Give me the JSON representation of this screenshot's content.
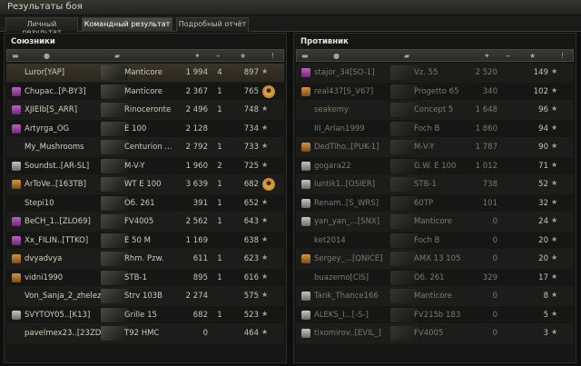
{
  "window": {
    "title": "Результаты боя"
  },
  "tabs": [
    {
      "label": "Личный результат"
    },
    {
      "label": "Командный результат",
      "active": true
    },
    {
      "label": "Подробный отчёт"
    }
  ],
  "allies": {
    "title": "Союзники",
    "rows": [
      {
        "name": "Luror[YAP]",
        "tank": "Manticore",
        "damage": "1 994",
        "frags": "4",
        "xp": "897",
        "rank": "none",
        "badge": "star",
        "me": true
      },
      {
        "name": "Chupac..[P-BY3]",
        "tank": "Manticore",
        "damage": "2 367",
        "frags": "1",
        "xp": "765",
        "rank": "plat",
        "badge": "medal"
      },
      {
        "name": "XJIEIb[S_ARR]",
        "tank": "Rinoceronte",
        "damage": "2 496",
        "frags": "1",
        "xp": "748",
        "rank": "plat",
        "badge": "star"
      },
      {
        "name": "Artyrga_OG",
        "tank": "E 100",
        "damage": "2 128",
        "frags": "",
        "xp": "734",
        "rank": "plat",
        "badge": "star"
      },
      {
        "name": "My_Mushrooms",
        "tank": "Centurion ...",
        "damage": "2 792",
        "frags": "1",
        "xp": "733",
        "rank": "none",
        "badge": "star"
      },
      {
        "name": "Soundst..[AR-SL]",
        "tank": "M-V-Y",
        "damage": "1 960",
        "frags": "2",
        "xp": "725",
        "rank": "silv",
        "badge": "star"
      },
      {
        "name": "ArToVe..[163TB]",
        "tank": "WT E 100",
        "damage": "3 639",
        "frags": "1",
        "xp": "682",
        "rank": "gold",
        "badge": "medal"
      },
      {
        "name": "Stepi10",
        "tank": "Об. 261",
        "damage": "391",
        "frags": "1",
        "xp": "652",
        "rank": "none",
        "badge": "star"
      },
      {
        "name": "BeCH_1..[ZLO69]",
        "tank": "FV4005",
        "damage": "2 562",
        "frags": "1",
        "xp": "643",
        "rank": "plat",
        "badge": "star"
      },
      {
        "name": "Xx_FILIN..[TTKO]",
        "tank": "E 50 M",
        "damage": "1 169",
        "frags": "",
        "xp": "638",
        "rank": "plat",
        "badge": "star"
      },
      {
        "name": "dvyadvya",
        "tank": "Rhm. Pzw.",
        "damage": "611",
        "frags": "1",
        "xp": "623",
        "rank": "gold",
        "badge": "star"
      },
      {
        "name": "vidni1990",
        "tank": "STB-1",
        "damage": "895",
        "frags": "1",
        "xp": "616",
        "rank": "gold",
        "badge": "star"
      },
      {
        "name": "Von_Sanja_2_zhelez",
        "tank": "Strv 103B",
        "damage": "2 274",
        "frags": "",
        "xp": "575",
        "rank": "none",
        "badge": "star"
      },
      {
        "name": "SVYTOY05..[K13]",
        "tank": "Grille 15",
        "damage": "682",
        "frags": "1",
        "xp": "523",
        "rank": "silv",
        "badge": "star"
      },
      {
        "name": "pavelmex23..[23ZD0]",
        "tank": "T92 HMC",
        "damage": "0",
        "frags": "",
        "xp": "464",
        "rank": "none",
        "badge": "star"
      }
    ]
  },
  "enemies": {
    "title": "Противник",
    "rows": [
      {
        "name": "stajor_34[SO-1]",
        "tank": "Vz. 55",
        "damage": "2 520",
        "frags": "",
        "xp": "149",
        "rank": "plat",
        "badge": "star",
        "dead": true
      },
      {
        "name": "real437[S_V67]",
        "tank": "Progetto 65",
        "damage": "340",
        "frags": "",
        "xp": "102",
        "rank": "gold",
        "badge": "star",
        "dead": true
      },
      {
        "name": "seakemy",
        "tank": "Concept 5",
        "damage": "1 648",
        "frags": "",
        "xp": "96",
        "rank": "none",
        "badge": "star",
        "dead": true
      },
      {
        "name": "III_Arlan1999",
        "tank": "Foch B",
        "damage": "1 860",
        "frags": "",
        "xp": "94",
        "rank": "none",
        "badge": "star",
        "dead": true
      },
      {
        "name": "DedTiho..[PUK-1]",
        "tank": "M-V-Y",
        "damage": "1 787",
        "frags": "",
        "xp": "90",
        "rank": "gold",
        "badge": "star",
        "dead": true
      },
      {
        "name": "gogara22",
        "tank": "G.W. E 100",
        "damage": "1 012",
        "frags": "",
        "xp": "71",
        "rank": "silv",
        "badge": "star",
        "dead": true
      },
      {
        "name": "luntik1..[OSIER]",
        "tank": "STB-1",
        "damage": "738",
        "frags": "",
        "xp": "52",
        "rank": "silv",
        "badge": "star",
        "dead": true
      },
      {
        "name": "Renam..[S_WRS]",
        "tank": "60TP",
        "damage": "101",
        "frags": "",
        "xp": "32",
        "rank": "silv",
        "badge": "star",
        "dead": true
      },
      {
        "name": "yan_yan_...[SNX]",
        "tank": "Manticore",
        "damage": "0",
        "frags": "",
        "xp": "24",
        "rank": "silv",
        "badge": "star",
        "dead": true
      },
      {
        "name": "ket2014",
        "tank": "Foch B",
        "damage": "0",
        "frags": "",
        "xp": "20",
        "rank": "none",
        "badge": "star",
        "dead": true
      },
      {
        "name": "Sergey_...[QNICE]",
        "tank": "AMX 13 105",
        "damage": "0",
        "frags": "",
        "xp": "20",
        "rank": "gold",
        "badge": "star",
        "dead": true
      },
      {
        "name": "buazerno[CIS]",
        "tank": "Об. 261",
        "damage": "329",
        "frags": "",
        "xp": "17",
        "rank": "none",
        "badge": "star",
        "dead": true
      },
      {
        "name": "Tank_Thance166",
        "tank": "Manticore",
        "damage": "0",
        "frags": "",
        "xp": "8",
        "rank": "silv",
        "badge": "star",
        "dead": true
      },
      {
        "name": "ALEKS_I...[-S-]",
        "tank": "FV215b 183",
        "damage": "0",
        "frags": "",
        "xp": "5",
        "rank": "silv",
        "badge": "star",
        "dead": true
      },
      {
        "name": "tixomirov..[EVIL_]",
        "tank": "FV4005",
        "damage": "0",
        "frags": "",
        "xp": "3",
        "rank": "silv",
        "badge": "star",
        "dead": true
      }
    ]
  },
  "icons": {
    "star": "★",
    "medal": "✸"
  }
}
